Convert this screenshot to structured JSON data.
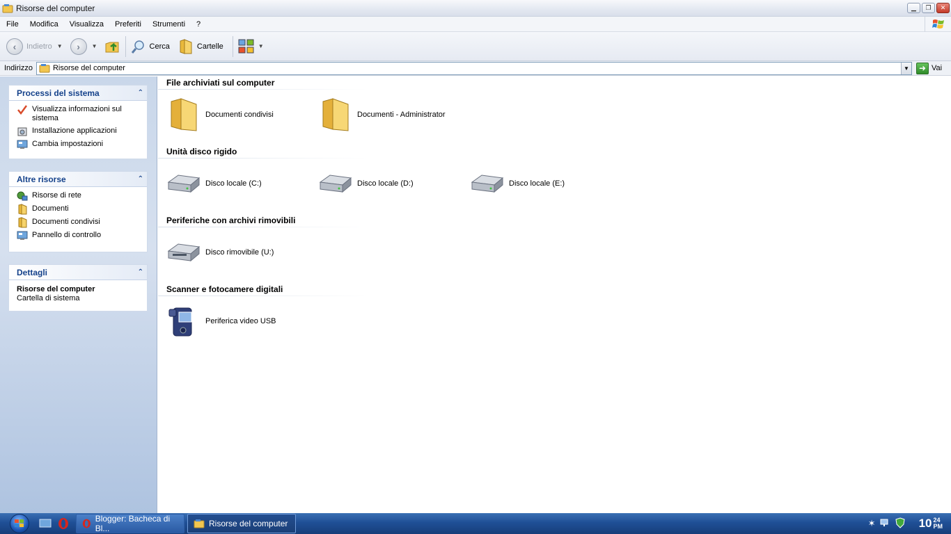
{
  "window": {
    "title": "Risorse del computer"
  },
  "menubar": {
    "items": [
      "File",
      "Modifica",
      "Visualizza",
      "Preferiti",
      "Strumenti",
      "?"
    ]
  },
  "toolbar": {
    "back_label": "Indietro",
    "search_label": "Cerca",
    "folders_label": "Cartelle"
  },
  "addressbar": {
    "label": "Indirizzo",
    "value": "Risorse del computer",
    "go_label": "Vai"
  },
  "taskpane": {
    "system_tasks": {
      "title": "Processi del sistema",
      "items": [
        {
          "label": "Visualizza informazioni sul sistema",
          "icon": "checkmark-icon"
        },
        {
          "label": "Installazione applicazioni",
          "icon": "install-apps-icon"
        },
        {
          "label": "Cambia impostazioni",
          "icon": "control-panel-icon"
        }
      ]
    },
    "other_places": {
      "title": "Altre risorse",
      "items": [
        {
          "label": "Risorse di rete",
          "icon": "network-icon"
        },
        {
          "label": "Documenti",
          "icon": "folder-icon"
        },
        {
          "label": "Documenti condivisi",
          "icon": "folder-icon"
        },
        {
          "label": "Pannello di controllo",
          "icon": "control-panel-icon"
        }
      ]
    },
    "details": {
      "title": "Dettagli",
      "name": "Risorse del computer",
      "type": "Cartella di sistema"
    }
  },
  "content": {
    "groups": [
      {
        "title": "File archiviati sul computer",
        "items": [
          {
            "label": "Documenti condivisi",
            "icon": "folder-icon"
          },
          {
            "label": "Documenti - Administrator",
            "icon": "folder-icon"
          }
        ]
      },
      {
        "title": "Unità disco rigido",
        "items": [
          {
            "label": "Disco locale (C:)",
            "icon": "hard-drive-icon"
          },
          {
            "label": "Disco locale (D:)",
            "icon": "hard-drive-icon"
          },
          {
            "label": "Disco locale (E:)",
            "icon": "hard-drive-icon"
          }
        ]
      },
      {
        "title": "Periferiche con archivi rimovibili",
        "items": [
          {
            "label": "Disco rimovibile (U:)",
            "icon": "removable-drive-icon"
          }
        ]
      },
      {
        "title": "Scanner e fotocamere digitali",
        "items": [
          {
            "label": "Periferica video USB",
            "icon": "camcorder-icon"
          }
        ]
      }
    ]
  },
  "taskbar": {
    "buttons": [
      {
        "label": "Blogger: Bacheca di Bl...",
        "icon": "opera-icon",
        "active": false
      },
      {
        "label": "Risorse del computer",
        "icon": "my-computer-icon",
        "active": true
      }
    ],
    "clock": {
      "time": "10",
      "minutes": "24",
      "ampm": "PM"
    }
  },
  "colors": {
    "panel_title": "#15428b",
    "taskbar": "#1f4f96"
  }
}
